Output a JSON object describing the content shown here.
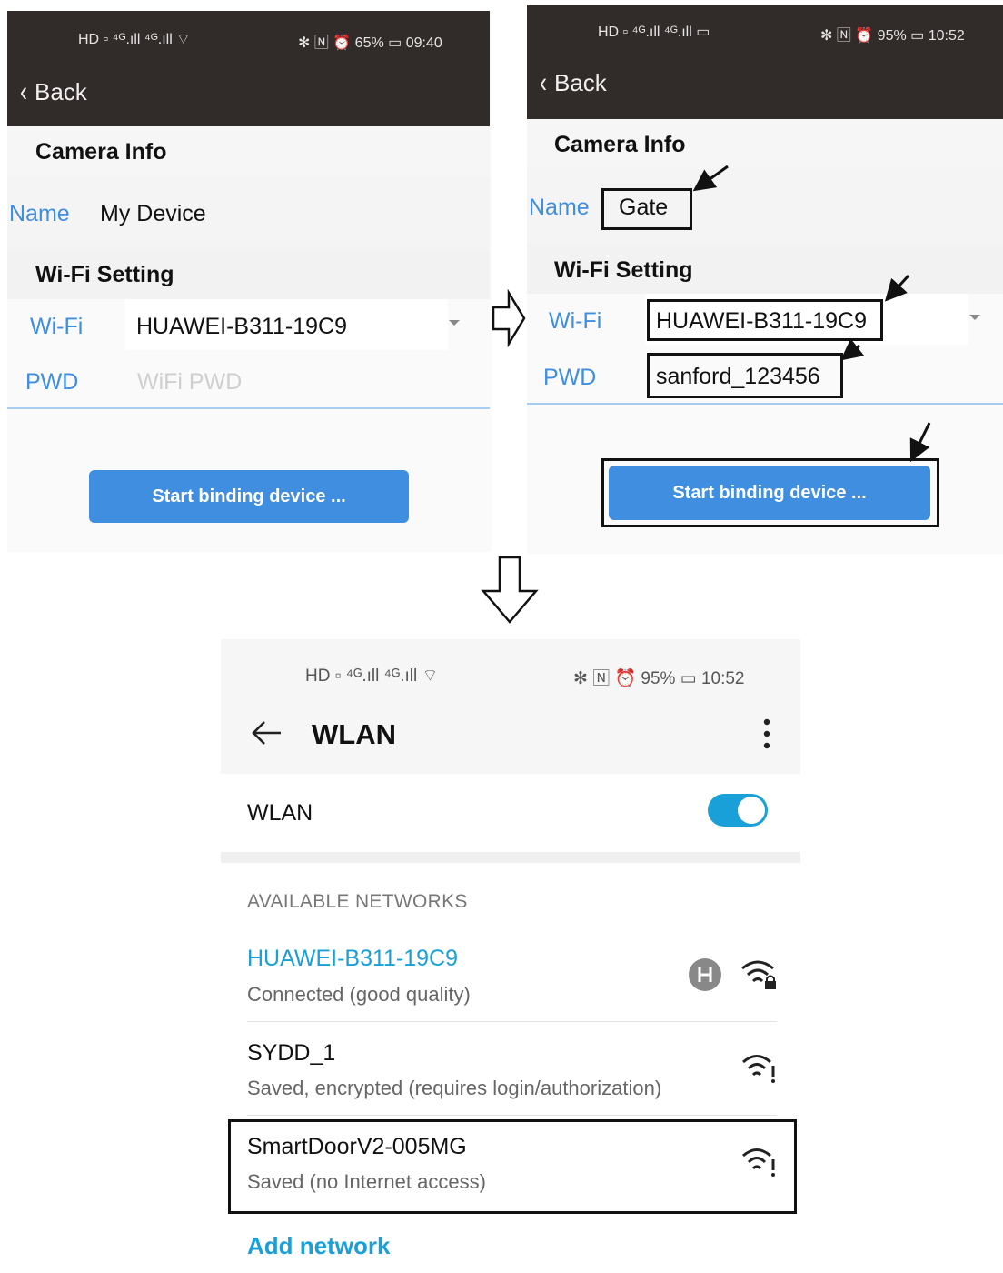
{
  "left_screen": {
    "status_left": "HD ▫ ⁴ᴳ.ıll ⁴ᴳ.ıll ⌔",
    "status_right": "✻ 🄽 ⏰ 65% ▭ 09:40",
    "back_label": "Back",
    "camera_info_title": "Camera Info",
    "name_label": "Name",
    "name_value": "My Device",
    "wifi_setting_title": "Wi-Fi Setting",
    "wifi_label": "Wi-Fi",
    "wifi_value": "HUAWEI-B311-19C9",
    "pwd_label": "PWD",
    "pwd_placeholder": "WiFi PWD",
    "bind_button": "Start binding device ..."
  },
  "right_screen": {
    "status_left": "HD ▫ ⁴ᴳ.ıll ⁴ᴳ.ıll ▭",
    "status_right": "✻ 🄽 ⏰ 95% ▭ 10:52",
    "back_label": "Back",
    "camera_info_title": "Camera Info",
    "name_label": "Name",
    "name_value": "Gate",
    "wifi_setting_title": "Wi-Fi Setting",
    "wifi_label": "Wi-Fi",
    "wifi_value": "HUAWEI-B311-19C9",
    "pwd_label": "PWD",
    "pwd_value": "sanford_123456",
    "bind_button": "Start binding device ..."
  },
  "wlan_screen": {
    "status_left": "HD ▫ ⁴ᴳ.ıll ⁴ᴳ.ıll ⌔",
    "status_right": "✻ 🄽 ⏰ 95% ▭ 10:52",
    "title": "WLAN",
    "toggle_label": "WLAN",
    "toggle_on": true,
    "available_header": "AVAILABLE NETWORKS",
    "networks": [
      {
        "name": "HUAWEI-B311-19C9",
        "status": "Connected (good quality)"
      },
      {
        "name": "SYDD_1",
        "status": "Saved, encrypted (requires login/authorization)"
      },
      {
        "name": "SmartDoorV2-005MG",
        "status": "Saved (no Internet access)"
      }
    ],
    "add_network": "Add network"
  },
  "colors": {
    "accent_blue": "#3f8ee0",
    "wlan_accent": "#1aa0d8",
    "dark_bar": "#312b29"
  },
  "icons": [
    "back-chevron-icon",
    "dropdown-caret-icon",
    "flow-arrow-right-icon",
    "flow-arrow-down-icon",
    "annotation-arrow-icon",
    "back-arrow-icon",
    "more-vert-icon",
    "toggle-switch-icon",
    "hotspot-share-icon",
    "wifi-lock-icon",
    "wifi-alert-icon"
  ]
}
